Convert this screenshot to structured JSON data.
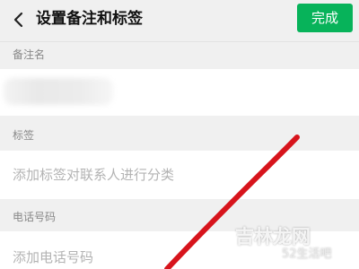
{
  "header": {
    "title": "设置备注和标签",
    "done_label": "完成",
    "back_icon": "chevron-left-icon"
  },
  "remark": {
    "label": "备注名",
    "value": ""
  },
  "tags": {
    "label": "标签",
    "placeholder": "添加标签对联系人进行分类"
  },
  "phone": {
    "label": "电话号码",
    "placeholder": "添加电话号码"
  },
  "watermark": {
    "main": "吉林龙网",
    "sub": "52生活吧"
  },
  "colors": {
    "accent": "#07b35a",
    "background": "#f0f0f0",
    "arrow": "#d7141c"
  }
}
